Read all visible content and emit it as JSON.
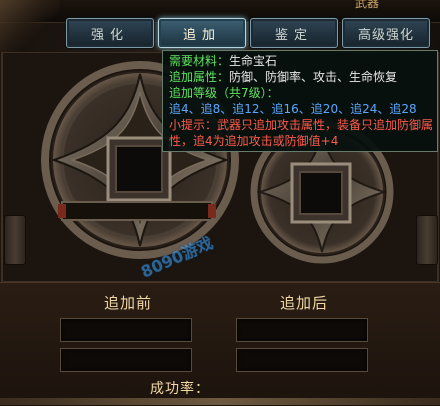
{
  "window": {
    "title_fragment": "武器"
  },
  "tabs": [
    {
      "label": "强化",
      "active": false
    },
    {
      "label": "追加",
      "active": true
    },
    {
      "label": "鉴定",
      "active": false
    },
    {
      "label": "高级强化",
      "active": false
    }
  ],
  "tooltip": {
    "line1_label": "需要材料：",
    "line1_value": "生命宝石",
    "line2_label": "追加属性：",
    "line2_value": "防御、防御率、攻击、生命恢复",
    "line3": "追加等级（共7级）：",
    "line4": "追4、追8、追12、追16、追20、追24、追28",
    "line5": "小提示：武器只追加攻击属性，装备只追加防御属",
    "line6": "性，追4为追加攻击或防御值+4"
  },
  "labels": {
    "before": "追加前",
    "after": "追加后",
    "success_rate": "成功率："
  },
  "fields": {
    "before_1": "",
    "before_2": "",
    "after_1": "",
    "after_2": ""
  },
  "watermark": "8090游戏",
  "colors": {
    "tab_active": "#3c6072",
    "tip_green": "#5fe25f",
    "tip_blue": "#5aa7ff",
    "tip_red": "#ff5a4a",
    "label_gold": "#f0d8a6"
  }
}
